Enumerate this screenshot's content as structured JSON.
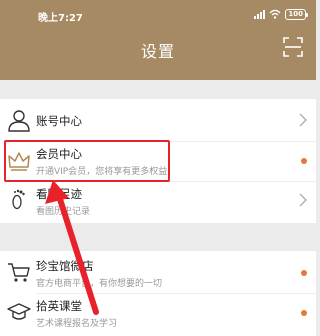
{
  "status_bar": {
    "time": "晚上7:27",
    "battery": "100"
  },
  "header": {
    "title": "设置"
  },
  "group1": [
    {
      "title": "账号中心",
      "subtitle": "",
      "icon": "user-icon",
      "trailing": "chevron"
    },
    {
      "title": "会员中心",
      "subtitle": "开通VIP会员，您将享有更多权益",
      "icon": "crown-icon",
      "trailing": "dot"
    },
    {
      "title": "看图足迹",
      "subtitle": "看图历史记录",
      "icon": "footprint-icon",
      "trailing": "chevron"
    }
  ],
  "group2": [
    {
      "title": "珍宝馆微店",
      "subtitle": "官方电商平台，有你想要的一切",
      "icon": "cart-icon",
      "trailing": "dot"
    },
    {
      "title": "拾英课堂",
      "subtitle": "艺术课程报名及学习",
      "icon": "graduation-cap-icon",
      "trailing": "dot"
    }
  ],
  "colors": {
    "header": "#a68a64",
    "dot": "#e5773d",
    "highlight": "#e8222b"
  }
}
